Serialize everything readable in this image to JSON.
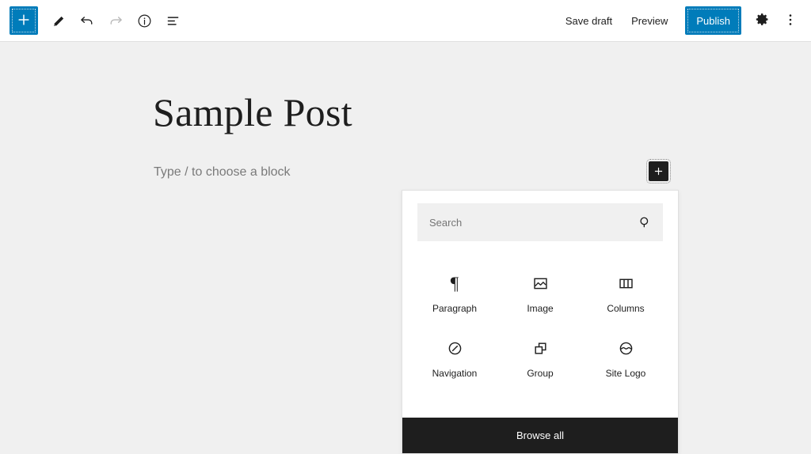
{
  "header": {
    "left_tools": [
      {
        "name": "toggle-block-inserter",
        "icon": "plus-icon",
        "label": "Toggle block inserter",
        "style": "primary"
      },
      {
        "name": "tools-pencil",
        "icon": "pencil-icon",
        "label": "Tools",
        "style": "plain"
      },
      {
        "name": "undo",
        "icon": "undo-icon",
        "label": "Undo",
        "style": "plain"
      },
      {
        "name": "redo",
        "icon": "redo-icon",
        "label": "Redo",
        "style": "disabled"
      },
      {
        "name": "details",
        "icon": "info-icon",
        "label": "Details",
        "style": "plain"
      },
      {
        "name": "list-view",
        "icon": "list-view-icon",
        "label": "List View",
        "style": "plain"
      }
    ],
    "save_draft_label": "Save draft",
    "preview_label": "Preview",
    "publish_label": "Publish",
    "settings_icon": "gear-icon",
    "settings_label": "Settings",
    "options_icon": "kebab-menu-icon",
    "options_label": "Options"
  },
  "canvas": {
    "post_title": "Sample Post",
    "block_placeholder": "Type / to choose a block",
    "appender_icon": "plus-icon",
    "appender_label": "Add block"
  },
  "inserter": {
    "search_value": "",
    "search_placeholder": "Search",
    "search_icon": "search-icon",
    "blocks": [
      {
        "label": "Paragraph",
        "icon": "paragraph-icon"
      },
      {
        "label": "Image",
        "icon": "image-icon"
      },
      {
        "label": "Columns",
        "icon": "columns-icon"
      },
      {
        "label": "Navigation",
        "icon": "navigation-compass-icon"
      },
      {
        "label": "Group",
        "icon": "group-icon"
      },
      {
        "label": "Site Logo",
        "icon": "site-logo-icon"
      }
    ],
    "browse_all_label": "Browse all"
  },
  "colors": {
    "accent": "#007cba",
    "canvas_bg": "#f0f0f0",
    "header_bg": "#ffffff",
    "dark": "#1e1e1e",
    "muted_text": "#757575"
  }
}
